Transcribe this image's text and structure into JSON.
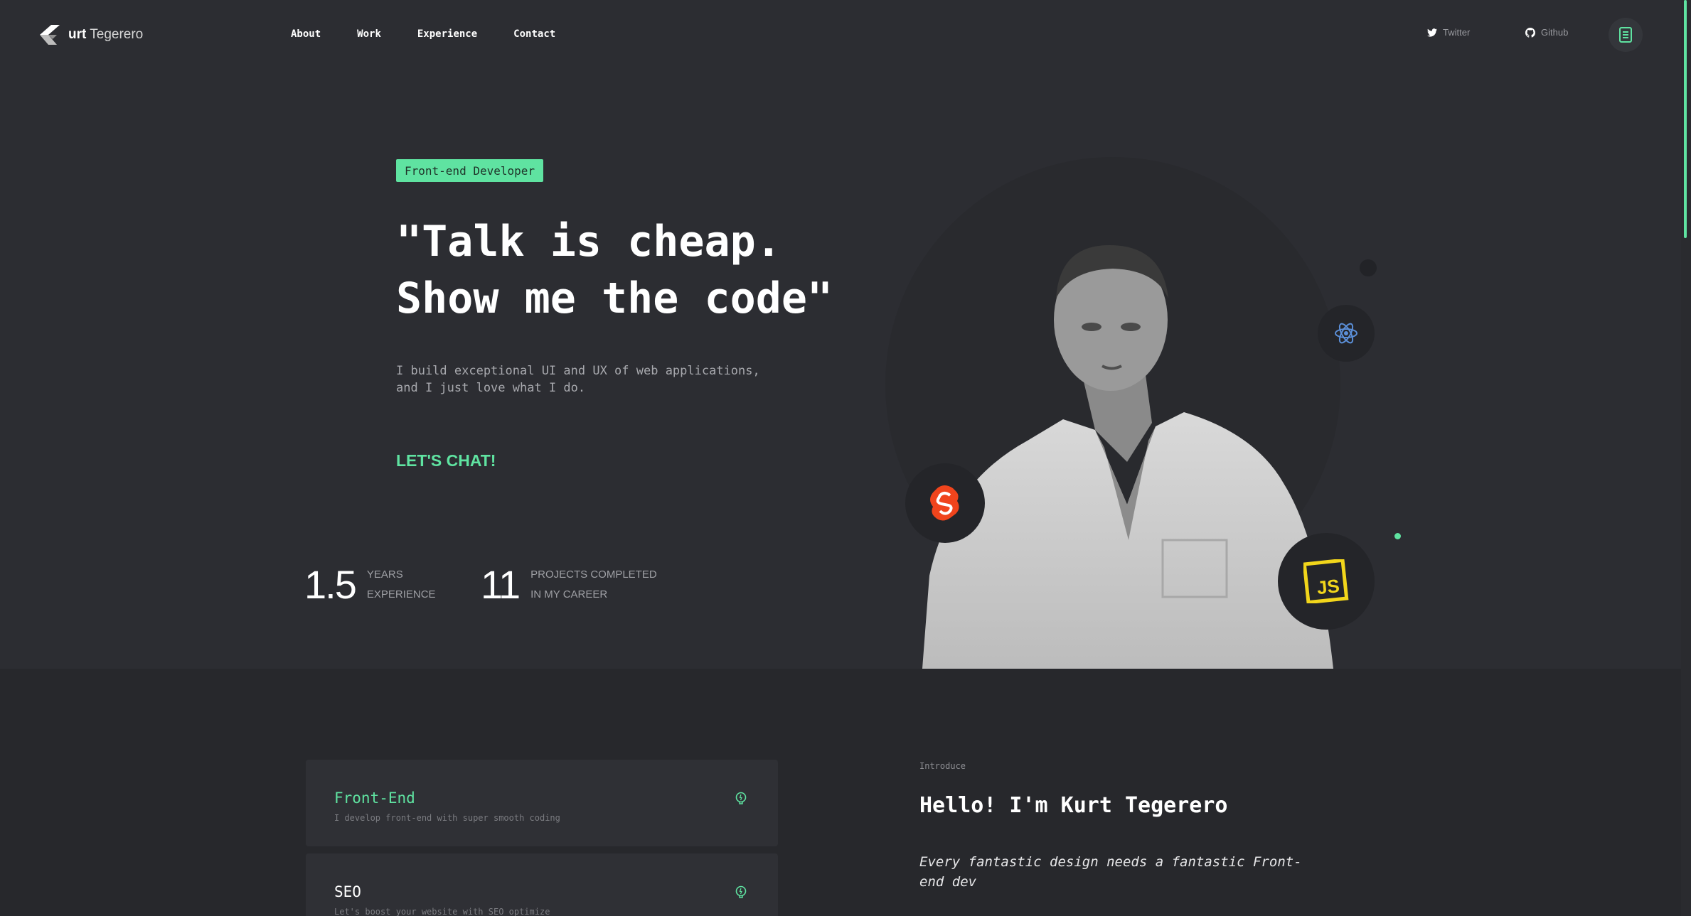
{
  "brand": {
    "logo_bold": "urt",
    "logo_rest": " Tegerero"
  },
  "nav": {
    "items": [
      "About",
      "Work",
      "Experience",
      "Contact"
    ]
  },
  "social": {
    "twitter": "Twitter",
    "github": "Github"
  },
  "hero": {
    "badge": "Front-end Developer",
    "headline_line1": "\"Talk is cheap.",
    "headline_line2": "Show me the code\"",
    "intro_line1": "I build exceptional UI and UX of web applications,",
    "intro_line2": "and I just love what I do.",
    "cta": "LET'S CHAT!",
    "stats": [
      {
        "value": "1.5",
        "label_line1": "YEARS",
        "label_line2": "EXPERIENCE"
      },
      {
        "value": "11",
        "label_line1": "PROJECTS COMPLETED",
        "label_line2": "IN MY CAREER"
      }
    ],
    "tech_icons": [
      "react-icon",
      "svelte-icon",
      "javascript-icon"
    ]
  },
  "services": [
    {
      "title": "Front-End",
      "desc": "I develop front-end with super smooth coding"
    },
    {
      "title": "SEO",
      "desc": "Let's boost your website with SEO optimize"
    }
  ],
  "introduce": {
    "kicker": "Introduce",
    "title": "Hello! I'm Kurt Tegerero",
    "quote": "Every fantastic design needs a fantastic Front-end dev"
  },
  "colors": {
    "accent": "#5fe3a1",
    "background": "#2c2d32",
    "section": "#27282c",
    "svelte": "#f0441c",
    "js": "#f2d61b",
    "react": "#5b8fd8"
  }
}
